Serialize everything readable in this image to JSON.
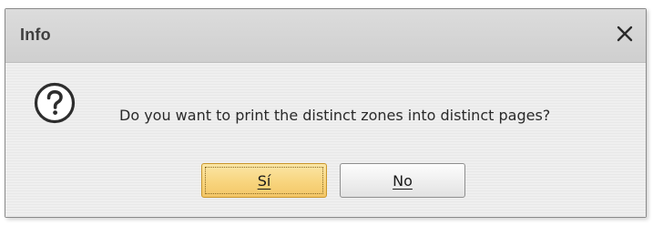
{
  "dialog": {
    "title": "Info",
    "message": "Do you want to print the distinct zones into distinct pages?",
    "buttons": {
      "yes_label": "Sí",
      "no_label": "No"
    },
    "icons": {
      "close": "close-icon",
      "question": "question-icon"
    },
    "colors": {
      "yes_button": "#f8d57e",
      "no_button": "#ededed"
    }
  }
}
